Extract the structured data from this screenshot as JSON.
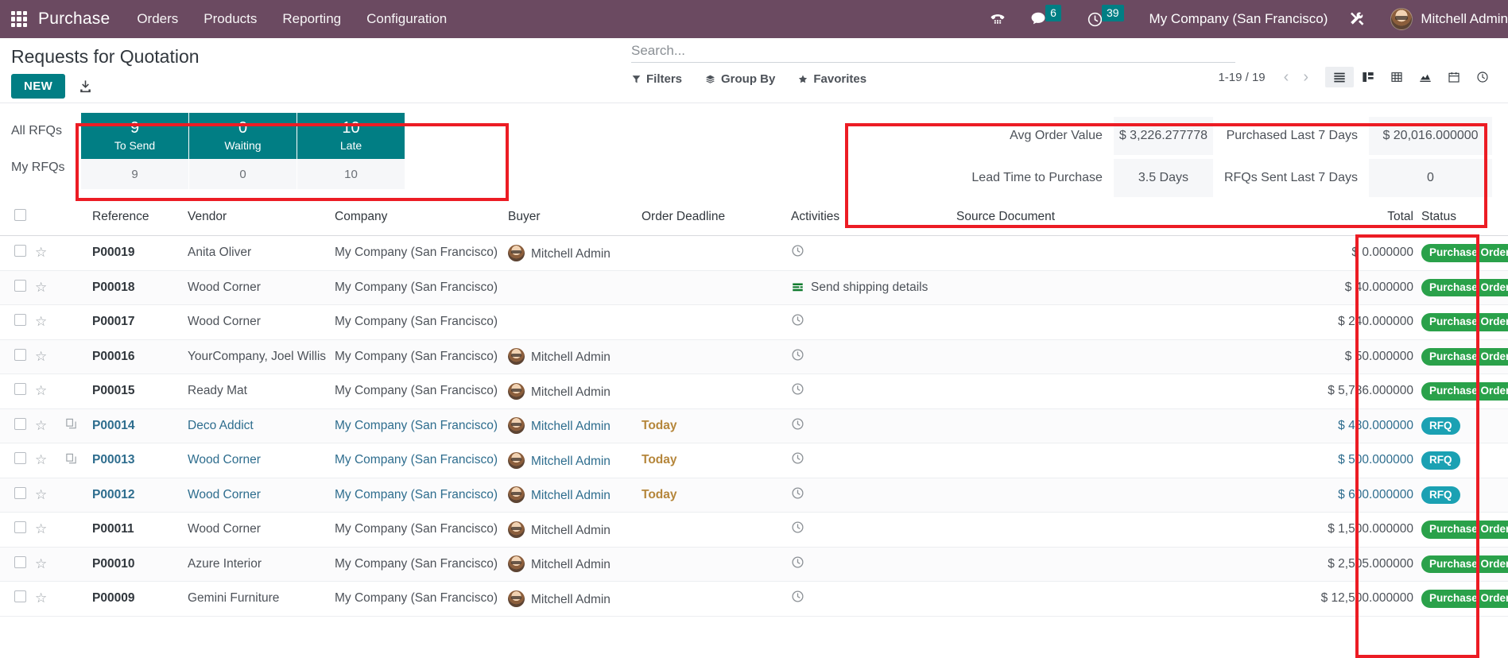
{
  "navbar": {
    "apps_icon": "apps-grid-icon",
    "brand": "Purchase",
    "menus": [
      "Orders",
      "Products",
      "Reporting",
      "Configuration"
    ],
    "phone_icon": "dialpad-icon",
    "messages_icon": "chat-icon",
    "messages_count": "6",
    "activities_icon": "clock-icon",
    "activities_count": "39",
    "company": "My Company (San Francisco)",
    "tools_icon": "tools-icon",
    "avatar_icon": "avatar",
    "user": "Mitchell Admin",
    "accent": "#6b4a61"
  },
  "control_panel": {
    "title": "Requests for Quotation",
    "new_label": "NEW",
    "import_icon": "import-icon",
    "search": {
      "value": "",
      "placeholder": "Search...",
      "icon": "search-icon"
    },
    "facets": [
      {
        "label": "Filters",
        "icon": "filter-icon"
      },
      {
        "label": "Group By",
        "icon": "layers-icon"
      },
      {
        "label": "Favorites",
        "icon": "star-icon"
      }
    ],
    "pager": "1-19 / 19",
    "prev_icon": "chevron-left-icon",
    "next_icon": "chevron-right-icon",
    "views": [
      {
        "name": "list-view",
        "icon": "list-icon",
        "active": true
      },
      {
        "name": "kanban-view",
        "icon": "kanban-icon",
        "active": false
      },
      {
        "name": "pivot-view",
        "icon": "pivot-icon",
        "active": false
      },
      {
        "name": "graph-view",
        "icon": "graph-icon",
        "active": false
      },
      {
        "name": "calendar-view",
        "icon": "calendar-icon",
        "active": false
      },
      {
        "name": "activity-view",
        "icon": "activity-clock-icon",
        "active": false
      }
    ]
  },
  "dashboard": {
    "row_labels": [
      "All RFQs",
      "My RFQs"
    ],
    "tiles": [
      {
        "value": "9",
        "label": "To Send"
      },
      {
        "value": "0",
        "label": "Waiting"
      },
      {
        "value": "10",
        "label": "Late"
      }
    ],
    "my_rfqs": [
      "9",
      "0",
      "10"
    ],
    "kpis": [
      {
        "label": "Avg Order Value",
        "value": "$ 3,226.277778"
      },
      {
        "label": "Purchased Last 7 Days",
        "value": "$ 20,016.000000"
      },
      {
        "label": "Lead Time to Purchase",
        "value": "3.5 Days"
      },
      {
        "label": "RFQs Sent Last 7 Days",
        "value": "0"
      }
    ],
    "tile_color": "#017e84"
  },
  "table": {
    "columns": [
      "Reference",
      "Vendor",
      "Company",
      "Buyer",
      "Order Deadline",
      "Activities",
      "Source Document",
      "Total",
      "Status"
    ],
    "settings_icon": "column-settings-icon",
    "rows": [
      {
        "ref": "P00019",
        "vendor": "Anita Oliver",
        "company": "My Company (San Francisco)",
        "buyer": "Mitchell Admin",
        "deadline": "",
        "activity": "",
        "activity_icon": "clock-icon",
        "source": "",
        "total": "$ 0.000000",
        "status": "Purchase Order",
        "status_type": "po",
        "unread": false,
        "has_doc": false
      },
      {
        "ref": "P00018",
        "vendor": "Wood Corner",
        "company": "My Company (San Francisco)",
        "buyer": "",
        "deadline": "",
        "activity": "Send shipping details",
        "activity_icon": "list-green-icon",
        "source": "",
        "total": "$ 40.000000",
        "status": "Purchase Order",
        "status_type": "po",
        "unread": false,
        "has_doc": false
      },
      {
        "ref": "P00017",
        "vendor": "Wood Corner",
        "company": "My Company (San Francisco)",
        "buyer": "",
        "deadline": "",
        "activity": "",
        "activity_icon": "clock-icon",
        "source": "",
        "total": "$ 240.000000",
        "status": "Purchase Order",
        "status_type": "po",
        "unread": false,
        "has_doc": false
      },
      {
        "ref": "P00016",
        "vendor": "YourCompany, Joel Willis",
        "company": "My Company (San Francisco)",
        "buyer": "Mitchell Admin",
        "deadline": "",
        "activity": "",
        "activity_icon": "clock-icon",
        "source": "",
        "total": "$ 50.000000",
        "status": "Purchase Order",
        "status_type": "po",
        "unread": false,
        "has_doc": false
      },
      {
        "ref": "P00015",
        "vendor": "Ready Mat",
        "company": "My Company (San Francisco)",
        "buyer": "Mitchell Admin",
        "deadline": "",
        "activity": "",
        "activity_icon": "clock-icon",
        "source": "",
        "total": "$ 5,736.000000",
        "status": "Purchase Order",
        "status_type": "po",
        "unread": false,
        "has_doc": false
      },
      {
        "ref": "P00014",
        "vendor": "Deco Addict",
        "company": "My Company (San Francisco)",
        "buyer": "Mitchell Admin",
        "deadline": "Today",
        "activity": "",
        "activity_icon": "clock-icon",
        "source": "",
        "total": "$ 480.000000",
        "status": "RFQ",
        "status_type": "rfq",
        "unread": true,
        "has_doc": true
      },
      {
        "ref": "P00013",
        "vendor": "Wood Corner",
        "company": "My Company (San Francisco)",
        "buyer": "Mitchell Admin",
        "deadline": "Today",
        "activity": "",
        "activity_icon": "clock-icon",
        "source": "",
        "total": "$ 500.000000",
        "status": "RFQ",
        "status_type": "rfq",
        "unread": true,
        "has_doc": true
      },
      {
        "ref": "P00012",
        "vendor": "Wood Corner",
        "company": "My Company (San Francisco)",
        "buyer": "Mitchell Admin",
        "deadline": "Today",
        "activity": "",
        "activity_icon": "clock-icon",
        "source": "",
        "total": "$ 600.000000",
        "status": "RFQ",
        "status_type": "rfq",
        "unread": true,
        "has_doc": false
      },
      {
        "ref": "P00011",
        "vendor": "Wood Corner",
        "company": "My Company (San Francisco)",
        "buyer": "Mitchell Admin",
        "deadline": "",
        "activity": "",
        "activity_icon": "clock-icon",
        "source": "",
        "total": "$ 1,500.000000",
        "status": "Purchase Order",
        "status_type": "po",
        "unread": false,
        "has_doc": false
      },
      {
        "ref": "P00010",
        "vendor": "Azure Interior",
        "company": "My Company (San Francisco)",
        "buyer": "Mitchell Admin",
        "deadline": "",
        "activity": "",
        "activity_icon": "clock-icon",
        "source": "",
        "total": "$ 2,505.000000",
        "status": "Purchase Order",
        "status_type": "po",
        "unread": false,
        "has_doc": false
      },
      {
        "ref": "P00009",
        "vendor": "Gemini Furniture",
        "company": "My Company (San Francisco)",
        "buyer": "Mitchell Admin",
        "deadline": "",
        "activity": "",
        "activity_icon": "clock-icon",
        "source": "",
        "total": "$ 12,500.000000",
        "status": "Purchase Order",
        "status_type": "po",
        "unread": false,
        "has_doc": false
      }
    ]
  },
  "annotations": {
    "color": "#ec1c24",
    "boxes": [
      "rfq-tiles-highlight",
      "kpi-panel-highlight",
      "status-column-highlight"
    ]
  }
}
